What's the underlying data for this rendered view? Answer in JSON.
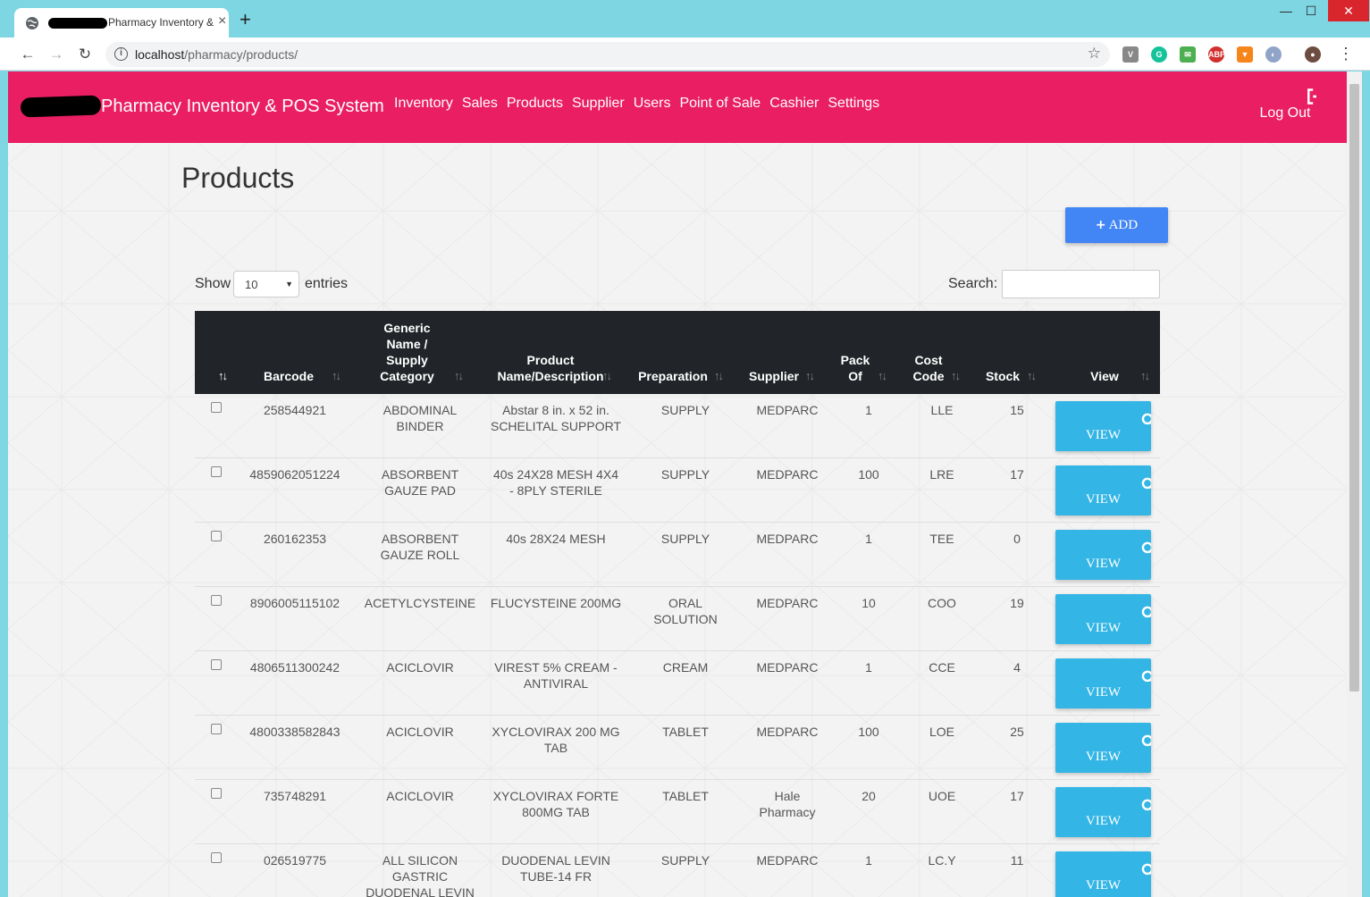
{
  "browser": {
    "tab_title": "Pharmacy Inventory & POS System",
    "url_host": "localhost",
    "url_path": "/pharmacy/products/",
    "minimize": "—",
    "maximize": "☐",
    "close": "✕",
    "new_tab": "+"
  },
  "navbar": {
    "brand": "Pharmacy Inventory & POS System",
    "links": [
      "Inventory",
      "Sales",
      "Products",
      "Supplier",
      "Users",
      "Point of Sale",
      "Cashier",
      "Settings"
    ],
    "logout": "Log Out",
    "color": "#e91e63"
  },
  "page": {
    "title": "Products",
    "add_button": "ADD",
    "show_label": "Show",
    "entries_label": "entries",
    "page_length": "10",
    "search_label": "Search:"
  },
  "table": {
    "headers": {
      "barcode": "Barcode",
      "generic": [
        "Generic",
        "Name /",
        "Supply",
        "Category"
      ],
      "product": [
        "Product",
        "Name/Description"
      ],
      "preparation": "Preparation",
      "supplier": "Supplier",
      "pack": [
        "Pack",
        "Of"
      ],
      "cost": [
        "Cost",
        "Code"
      ],
      "stock": "Stock",
      "view": "View"
    },
    "view_label": "VIEW",
    "rows": [
      {
        "barcode": "258544921",
        "generic": [
          "ABDOMINAL",
          "BINDER"
        ],
        "product": [
          "Abstar 8 in. x 52 in.",
          "SCHELITAL SUPPORT"
        ],
        "preparation": [
          "SUPPLY"
        ],
        "supplier": [
          "MEDPARC"
        ],
        "pack": "1",
        "cost": "LLE",
        "stock": "15"
      },
      {
        "barcode": "4859062051224",
        "generic": [
          "ABSORBENT",
          "GAUZE PAD"
        ],
        "product": [
          "40s 24X28 MESH 4X4",
          "- 8PLY STERILE"
        ],
        "preparation": [
          "SUPPLY"
        ],
        "supplier": [
          "MEDPARC"
        ],
        "pack": "100",
        "cost": "LRE",
        "stock": "17"
      },
      {
        "barcode": "260162353",
        "generic": [
          "ABSORBENT",
          "GAUZE ROLL"
        ],
        "product": [
          "40s 28X24 MESH"
        ],
        "preparation": [
          "SUPPLY"
        ],
        "supplier": [
          "MEDPARC"
        ],
        "pack": "1",
        "cost": "TEE",
        "stock": "0"
      },
      {
        "barcode": "8906005115102",
        "generic": [
          "ACETYLCYSTEINE"
        ],
        "product": [
          "FLUCYSTEINE 200MG"
        ],
        "preparation": [
          "ORAL",
          "SOLUTION"
        ],
        "supplier": [
          "MEDPARC"
        ],
        "pack": "10",
        "cost": "COO",
        "stock": "19"
      },
      {
        "barcode": "4806511300242",
        "generic": [
          "ACICLOVIR"
        ],
        "product": [
          "VIREST 5% CREAM -",
          "ANTIVIRAL"
        ],
        "preparation": [
          "CREAM"
        ],
        "supplier": [
          "MEDPARC"
        ],
        "pack": "1",
        "cost": "CCE",
        "stock": "4"
      },
      {
        "barcode": "4800338582843",
        "generic": [
          "ACICLOVIR"
        ],
        "product": [
          "XYCLOVIRAX 200 MG",
          "TAB"
        ],
        "preparation": [
          "TABLET"
        ],
        "supplier": [
          "MEDPARC"
        ],
        "pack": "100",
        "cost": "LOE",
        "stock": "25"
      },
      {
        "barcode": "735748291",
        "generic": [
          "ACICLOVIR"
        ],
        "product": [
          "XYCLOVIRAX FORTE",
          "800MG TAB"
        ],
        "preparation": [
          "TABLET"
        ],
        "supplier": [
          "Hale",
          "Pharmacy"
        ],
        "pack": "20",
        "cost": "UOE",
        "stock": "17"
      },
      {
        "barcode": "026519775",
        "generic": [
          "ALL SILICON",
          "GASTRIC",
          "DUODENAL LEVIN"
        ],
        "product": [
          "DUODENAL LEVIN",
          "TUBE-14 FR"
        ],
        "preparation": [
          "SUPPLY"
        ],
        "supplier": [
          "MEDPARC"
        ],
        "pack": "1",
        "cost": "LC.Y",
        "stock": "11"
      }
    ]
  }
}
